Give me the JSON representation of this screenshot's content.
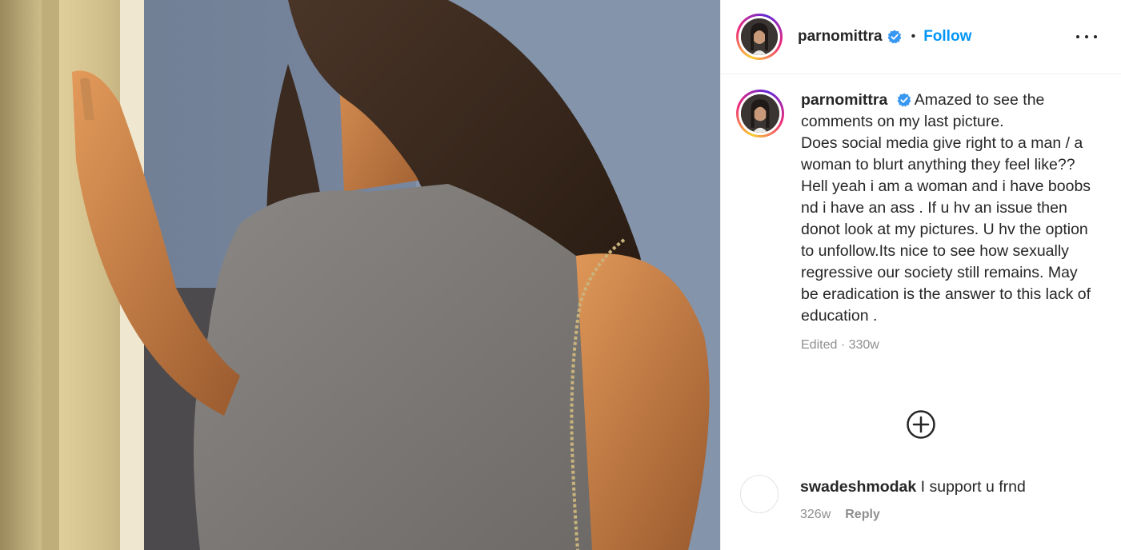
{
  "post": {
    "username": "parnomittra",
    "verified_icon": "verified-badge-icon",
    "follow_label": "Follow",
    "separator": "•",
    "more_icon": "more-options-icon"
  },
  "caption": {
    "username": "parnomittra",
    "text": "Amazed to see the comments on my last picture.\nDoes social media give right to a man / a woman to blurt anything they feel like?? Hell yeah i am a woman and i have boobs nd i have an ass . If u hv an issue then donot look at my pictures. U hv the option to unfollow.Its nice to see how sexually regressive our society still remains. May be eradication is the answer to this lack of education .",
    "meta": "Edited · 330w"
  },
  "load_more_icon": "add-circle-icon",
  "comments": [
    {
      "username": "swadeshmodak",
      "text": "I support u frnd",
      "time": "326w",
      "reply_label": "Reply"
    }
  ],
  "colors": {
    "accent": "#0095f6",
    "text": "#262626",
    "muted": "#8e8e8e",
    "border": "#efefef"
  }
}
